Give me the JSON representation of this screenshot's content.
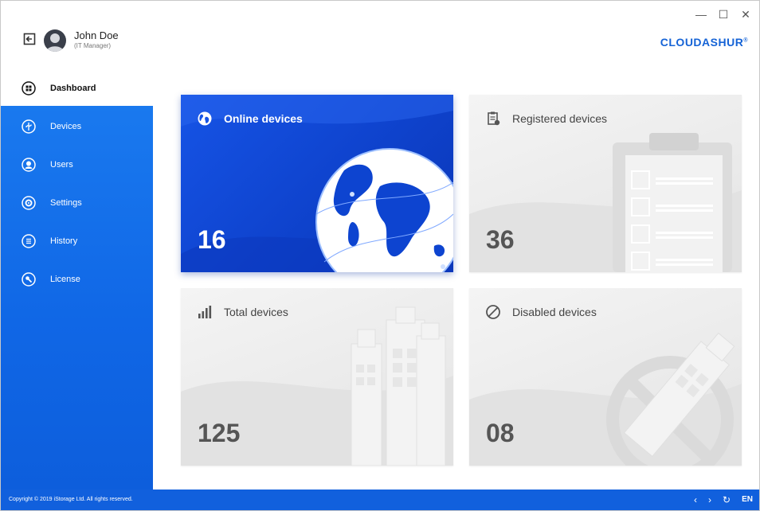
{
  "user": {
    "name": "John Doe",
    "role": "(IT Manager)"
  },
  "brand": {
    "name": "CLOUDASHUR",
    "mark": "®",
    "color": "#1563d6"
  },
  "window": {
    "minimize": "—",
    "maximize": "☐",
    "close": "✕"
  },
  "sidebar": {
    "items": [
      {
        "label": "Dashboard",
        "icon": "dashboard-icon",
        "active": true
      },
      {
        "label": "Devices",
        "icon": "usb-icon",
        "active": false
      },
      {
        "label": "Users",
        "icon": "user-icon",
        "active": false
      },
      {
        "label": "Settings",
        "icon": "gear-icon",
        "active": false
      },
      {
        "label": "History",
        "icon": "list-icon",
        "active": false
      },
      {
        "label": "License",
        "icon": "key-icon",
        "active": false
      }
    ]
  },
  "cards": {
    "online": {
      "title": "Online devices",
      "count": "16",
      "icon": "globe-icon"
    },
    "registered": {
      "title": "Registered devices",
      "count": "36",
      "icon": "clipboard-icon"
    },
    "total": {
      "title": "Total devices",
      "count": "125",
      "icon": "signal-bars-icon"
    },
    "disabled": {
      "title": "Disabled devices",
      "count": "08",
      "icon": "prohibited-icon"
    }
  },
  "footer": {
    "copyright": "Copyright © 2019 iStorage Ltd. All rights reserved.",
    "prev": "‹",
    "next": "›",
    "refresh": "↻",
    "language": "EN"
  },
  "colors": {
    "sidebar": "#1067e6",
    "footer": "#1160dd",
    "online_card": "#1654e6"
  }
}
